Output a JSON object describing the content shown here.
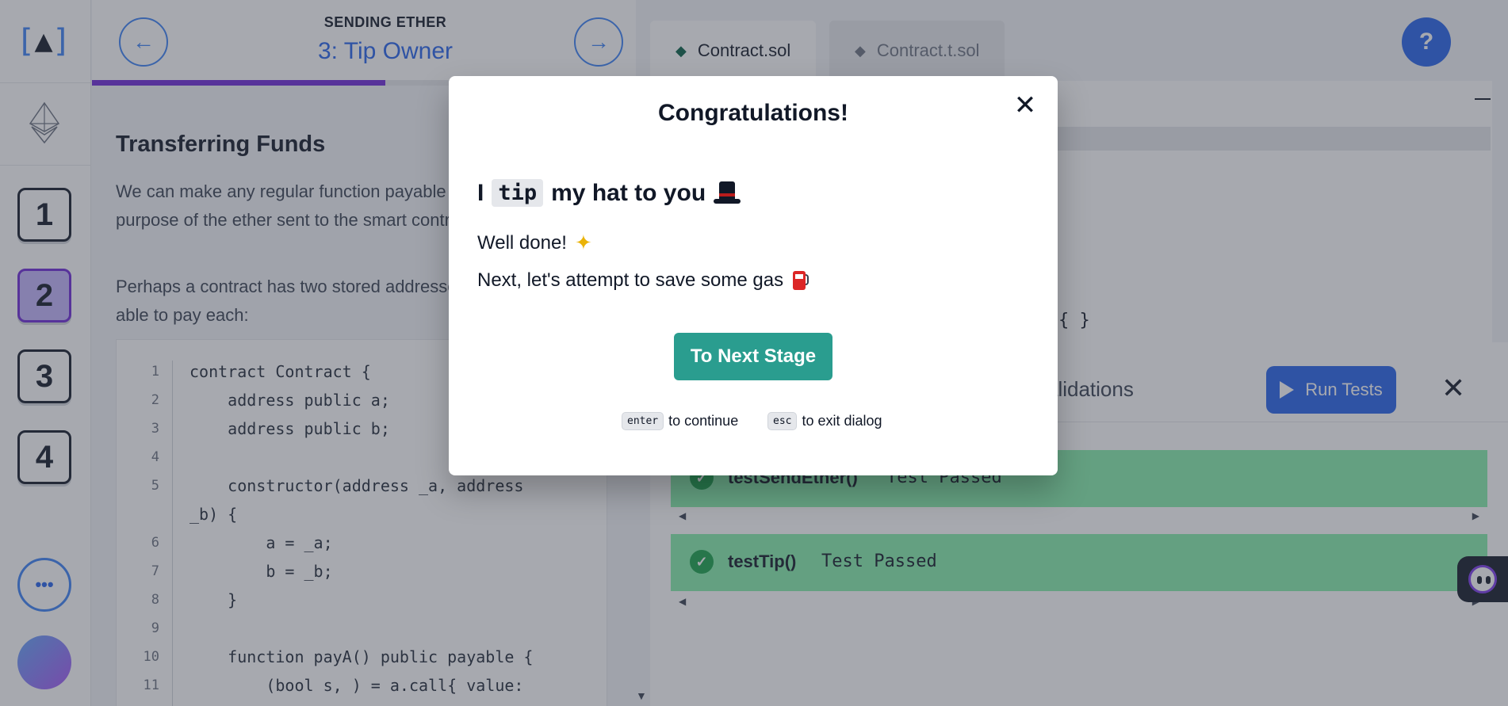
{
  "rail": {
    "logo_bracket_open": "[",
    "logo_bracket_close": "]",
    "logo_mark": "▲",
    "stages": [
      "1",
      "2",
      "3",
      "4"
    ],
    "active_stage": "2",
    "more": "•••"
  },
  "lesson": {
    "eyebrow": "SENDING ETHER",
    "title": "3: Tip Owner",
    "progress_percent": 54,
    "heading": "Transferring Funds",
    "para1": "We can make any regular function payable to differentiate the purpose of the ether sent to the smart contract.",
    "para2": "Perhaps a contract has two stored addresses and wants to be able to pay each:",
    "code": [
      {
        "n": "1",
        "t": "contract Contract {"
      },
      {
        "n": "2",
        "t": "    address public a;"
      },
      {
        "n": "3",
        "t": "    address public b;"
      },
      {
        "n": "4",
        "t": ""
      },
      {
        "n": "5",
        "t": "    constructor(address _a, address"
      },
      {
        "n": "",
        "t": "_b) {"
      },
      {
        "n": "6",
        "t": "        a = _a;"
      },
      {
        "n": "7",
        "t": "        b = _b;"
      },
      {
        "n": "8",
        "t": "    }"
      },
      {
        "n": "9",
        "t": ""
      },
      {
        "n": "10",
        "t": "    function payA() public payable {"
      },
      {
        "n": "11",
        "t": "        (bool s, ) = a.call{ value:"
      }
    ]
  },
  "editor": {
    "tabs": [
      "Contract.sol",
      "Contract.t.sol"
    ],
    "help": "?",
    "brace": "{ }"
  },
  "tests": {
    "title_fragment": "alidations",
    "run_label": "Run Tests",
    "rows": [
      {
        "name": "testSendEther()",
        "status": "Test Passed"
      },
      {
        "name": "testTip()",
        "status": "Test Passed"
      }
    ]
  },
  "modal": {
    "title": "Congratulations!",
    "heading_prefix": "I",
    "heading_code": "tip",
    "heading_suffix": "my hat to you",
    "line1": "Well done!",
    "line2": "Next, let's attempt to save some gas",
    "button": "To Next Stage",
    "hint_enter_key": "enter",
    "hint_enter_text": "to continue",
    "hint_esc_key": "esc",
    "hint_esc_text": "to exit dialog"
  },
  "colors": {
    "accent": "#2563eb",
    "next_button": "#2a9d8f",
    "active_stage": "#c4b5fd",
    "test_passed": "#86efac"
  }
}
